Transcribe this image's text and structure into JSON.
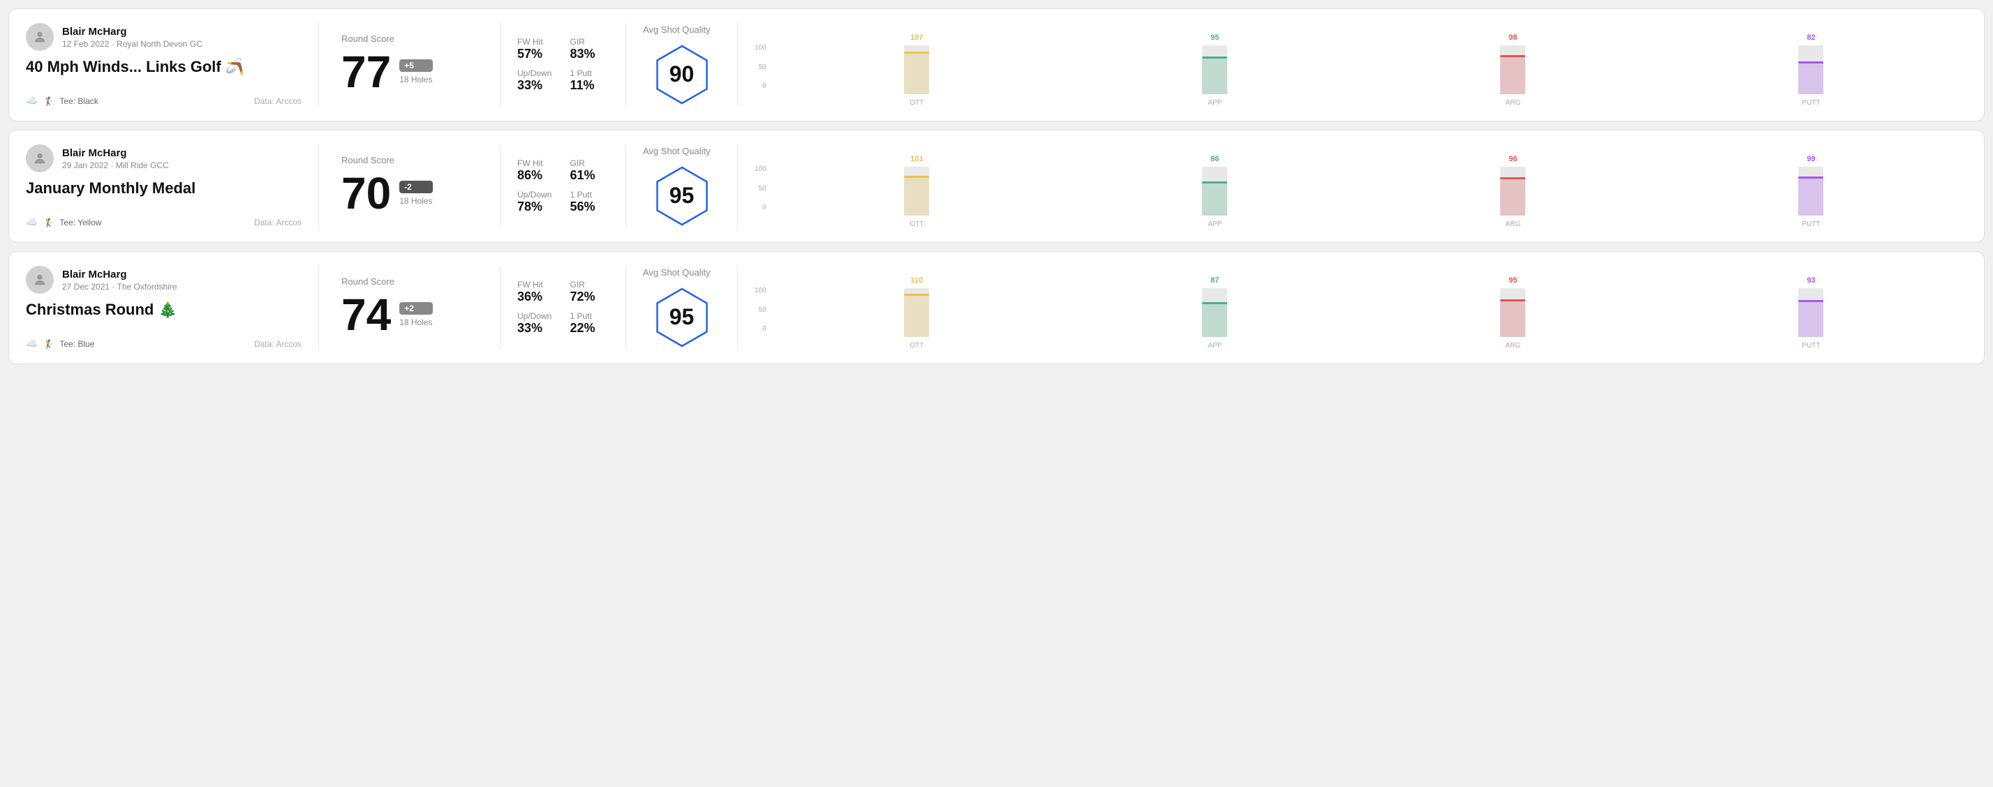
{
  "rounds": [
    {
      "id": "round1",
      "player": "Blair McHarg",
      "date_course": "12 Feb 2022 · Royal North Devon GC",
      "title": "40 Mph Winds... Links Golf 🪃",
      "tee": "Black",
      "data_source": "Data: Arccos",
      "round_score_label": "Round Score",
      "score": "77",
      "score_diff": "+5",
      "score_diff_type": "positive",
      "holes": "18 Holes",
      "fw_hit_label": "FW Hit",
      "fw_hit": "57%",
      "gir_label": "GIR",
      "gir": "83%",
      "updown_label": "Up/Down",
      "updown": "33%",
      "oneputt_label": "1 Putt",
      "oneputt": "11%",
      "quality_label": "Avg Shot Quality",
      "quality_score": "90",
      "chart": {
        "bars": [
          {
            "label": "OTT",
            "value": 107,
            "color": "#e8c44a",
            "max": 130
          },
          {
            "label": "APP",
            "value": 95,
            "color": "#4caf87",
            "max": 130
          },
          {
            "label": "ARG",
            "value": 98,
            "color": "#e05555",
            "max": 130
          },
          {
            "label": "PUTT",
            "value": 82,
            "color": "#a855f7",
            "max": 130
          }
        ]
      }
    },
    {
      "id": "round2",
      "player": "Blair McHarg",
      "date_course": "29 Jan 2022 · Mill Ride GCC",
      "title": "January Monthly Medal",
      "tee": "Yellow",
      "data_source": "Data: Arccos",
      "round_score_label": "Round Score",
      "score": "70",
      "score_diff": "-2",
      "score_diff_type": "negative",
      "holes": "18 Holes",
      "fw_hit_label": "FW Hit",
      "fw_hit": "86%",
      "gir_label": "GIR",
      "gir": "61%",
      "updown_label": "Up/Down",
      "updown": "78%",
      "oneputt_label": "1 Putt",
      "oneputt": "56%",
      "quality_label": "Avg Shot Quality",
      "quality_score": "95",
      "chart": {
        "bars": [
          {
            "label": "OTT",
            "value": 101,
            "color": "#e8c44a",
            "max": 130
          },
          {
            "label": "APP",
            "value": 86,
            "color": "#4caf87",
            "max": 130
          },
          {
            "label": "ARG",
            "value": 96,
            "color": "#e05555",
            "max": 130
          },
          {
            "label": "PUTT",
            "value": 99,
            "color": "#a855f7",
            "max": 130
          }
        ]
      }
    },
    {
      "id": "round3",
      "player": "Blair McHarg",
      "date_course": "27 Dec 2021 · The Oxfordshire",
      "title": "Christmas Round 🎄",
      "tee": "Blue",
      "data_source": "Data: Arccos",
      "round_score_label": "Round Score",
      "score": "74",
      "score_diff": "+2",
      "score_diff_type": "positive",
      "holes": "18 Holes",
      "fw_hit_label": "FW Hit",
      "fw_hit": "36%",
      "gir_label": "GIR",
      "gir": "72%",
      "updown_label": "Up/Down",
      "updown": "33%",
      "oneputt_label": "1 Putt",
      "oneputt": "22%",
      "quality_label": "Avg Shot Quality",
      "quality_score": "95",
      "chart": {
        "bars": [
          {
            "label": "OTT",
            "value": 110,
            "color": "#e8c44a",
            "max": 130
          },
          {
            "label": "APP",
            "value": 87,
            "color": "#4caf87",
            "max": 130
          },
          {
            "label": "ARG",
            "value": 95,
            "color": "#e05555",
            "max": 130
          },
          {
            "label": "PUTT",
            "value": 93,
            "color": "#a855f7",
            "max": 130
          }
        ]
      }
    }
  ],
  "y_axis_labels": [
    "100",
    "50",
    "0"
  ]
}
